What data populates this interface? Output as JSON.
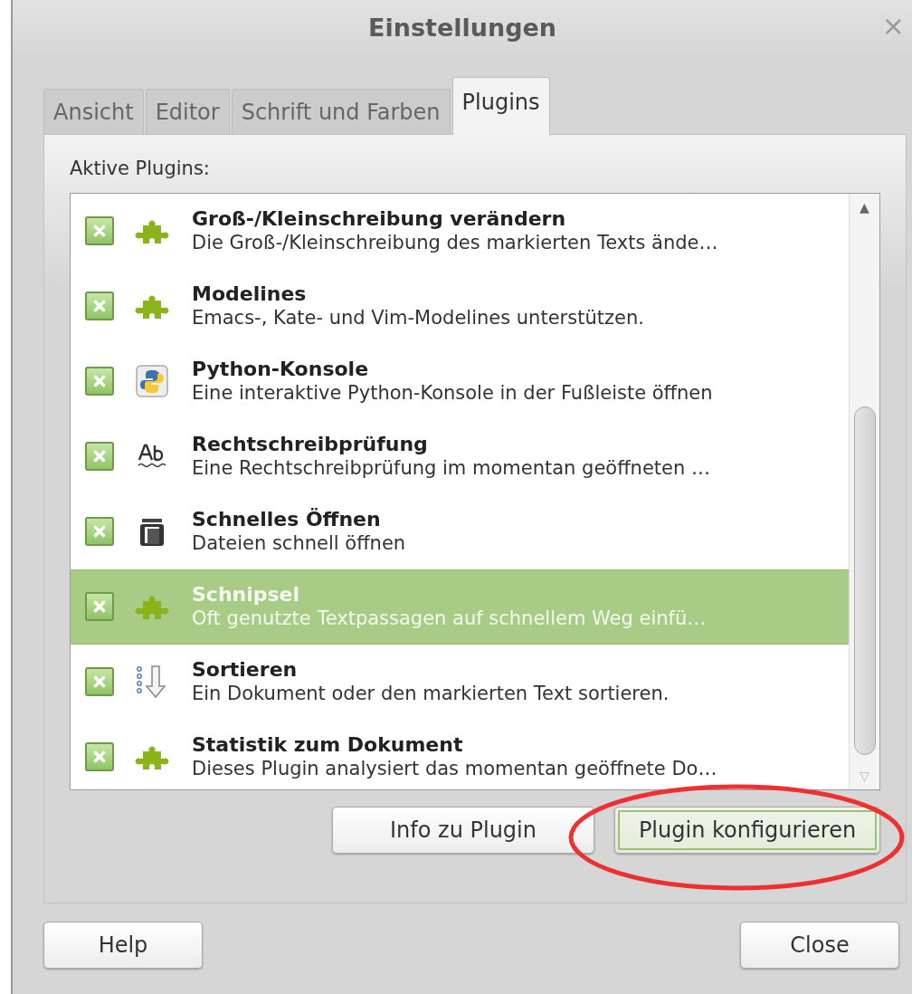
{
  "window": {
    "title": "Einstellungen",
    "close": "×"
  },
  "tabs": [
    {
      "label": "Ansicht",
      "selected": false
    },
    {
      "label": "Editor",
      "selected": false
    },
    {
      "label": "Schrift und Farben",
      "selected": false
    },
    {
      "label": "Plugins",
      "selected": true
    }
  ],
  "plugins": {
    "label": "Aktive Plugins:",
    "items": [
      {
        "kind": "puzzle",
        "name": "Groß-/Kleinschreibung verändern",
        "description": "Die Groß-/Kleinschreibung des markierten Texts ände…",
        "checked": true,
        "selected": false
      },
      {
        "kind": "puzzle",
        "name": "Modelines",
        "description": "Emacs-, Kate- und Vim-Modelines unterstützen.",
        "checked": true,
        "selected": false
      },
      {
        "kind": "python",
        "name": "Python-Konsole",
        "description": "Eine interaktive Python-Konsole in der Fußleiste öffnen",
        "checked": true,
        "selected": false
      },
      {
        "kind": "spell",
        "name": "Rechtschreibprüfung",
        "description": "Eine Rechtschreibprüfung im momentan geöffneten …",
        "checked": true,
        "selected": false
      },
      {
        "kind": "open",
        "name": "Schnelles Öffnen",
        "description": "Dateien schnell öffnen",
        "checked": true,
        "selected": false
      },
      {
        "kind": "puzzle",
        "name": "Schnipsel",
        "description": "Oft genutzte Textpassagen auf schnellem Weg einfü…",
        "checked": true,
        "selected": true
      },
      {
        "kind": "sort",
        "name": "Sortieren",
        "description": "Ein Dokument oder den markierten Text sortieren.",
        "checked": true,
        "selected": false
      },
      {
        "kind": "puzzle",
        "name": "Statistik zum Dokument",
        "description": "Dieses Plugin analysiert das momentan geöffnete Do…",
        "checked": true,
        "selected": false
      }
    ],
    "scroll_up": "▲",
    "scroll_down": "▽"
  },
  "plugin_buttons": [
    {
      "label": "Info zu Plugin",
      "focused": false
    },
    {
      "label": "Plugin konfigurieren",
      "focused": true
    }
  ],
  "footer_buttons": [
    {
      "label": "Help"
    },
    {
      "label": "Close"
    }
  ],
  "annotations": [
    {
      "kind": "ellipse"
    }
  ]
}
